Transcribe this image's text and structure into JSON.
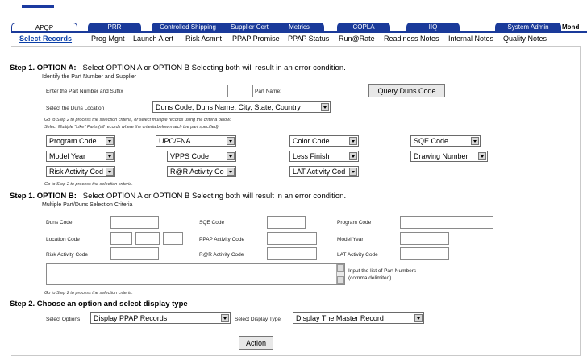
{
  "tabs": [
    {
      "label": "APQP",
      "active": true
    },
    {
      "label": "PRR",
      "active": false
    },
    {
      "label": "Controlled Shipping",
      "active": false
    },
    {
      "label": "Supplier Cert",
      "active": false
    },
    {
      "label": "Metrics",
      "active": false
    },
    {
      "label": "COPLA",
      "active": false
    },
    {
      "label": "IIQ",
      "active": false
    },
    {
      "label": "System Admin",
      "active": false
    }
  ],
  "tab_overflow": "Mond",
  "subnav": [
    {
      "label": "Select Records",
      "active": true
    },
    {
      "label": "Prog Mgnt"
    },
    {
      "label": "Launch Alert"
    },
    {
      "label": "Risk Asmnt"
    },
    {
      "label": "PPAP Promise"
    },
    {
      "label": "PPAP Status"
    },
    {
      "label": "Run@Rate"
    },
    {
      "label": "Readiness Notes"
    },
    {
      "label": "Internal Notes"
    },
    {
      "label": "Quality Notes"
    }
  ],
  "step1a": {
    "heading_prefix": "Step 1. OPTION A:",
    "heading_desc": "Select OPTION A or OPTION B  Selecting both will result in an error condition.",
    "subheading": "Identify the Part Number and Supplier",
    "part_label": "Enter the Part Number and Suffix",
    "part_name_label": "Part Name:",
    "query_button": "Query Duns Code",
    "duns_location_label": "Select the Duns Location",
    "duns_location_value": "Duns Code, Duns Name, City, State, Country",
    "note1": "Go to Step 2 to process the selection criteria, or select multiple records using the criteria below.",
    "note2": "Select Multiple \"Like\" Parts (all records where the criteria below match the part specified).",
    "selects": {
      "program_code": "Program Code",
      "upc_fna": "UPC/FNA",
      "color_code": "Color Code",
      "sqe_code": "SQE Code",
      "model_year": "Model Year",
      "vpps_code": "VPPS Code",
      "less_finish": "Less Finish",
      "drawing_number": "Drawing Number",
      "risk_activity": "Risk Activity Cod",
      "rr_activity": "R@R Activity Cod",
      "lat_activity": "LAT Activity Cod"
    },
    "note3": "Go to Step 2 to process the selection criteria."
  },
  "step1b": {
    "heading_prefix": "Step 1. OPTION B:",
    "heading_desc": "Select OPTION A or OPTION B  Selecting both will result in an error condition.",
    "subheading": "Multiple Part/Duns Selection Criteria",
    "duns_code_label": "Duns Code",
    "sqe_code_label": "SQE Code",
    "program_code_label": "Program Code",
    "location_code_label": "Location Code",
    "ppap_activity_label": "PPAP Activity Code",
    "model_year_label": "Model Year",
    "risk_activity_label": "Risk Activity Code",
    "rr_activity_label": "R@R Activity Code",
    "lat_activity_label": "LAT Activity Code",
    "part_list_label_1": "Input the list of Part Numbers",
    "part_list_label_2": "(comma delimited)",
    "note": "Go to Step 2 to process the selection criteria."
  },
  "step2": {
    "heading": "Step 2.  Choose an option and select display type",
    "select_options_label": "Select Options",
    "select_options_value": "Display PPAP Records",
    "display_type_label": "Select Display Type",
    "display_type_value": "Display The Master Record",
    "action_button": "Action"
  }
}
